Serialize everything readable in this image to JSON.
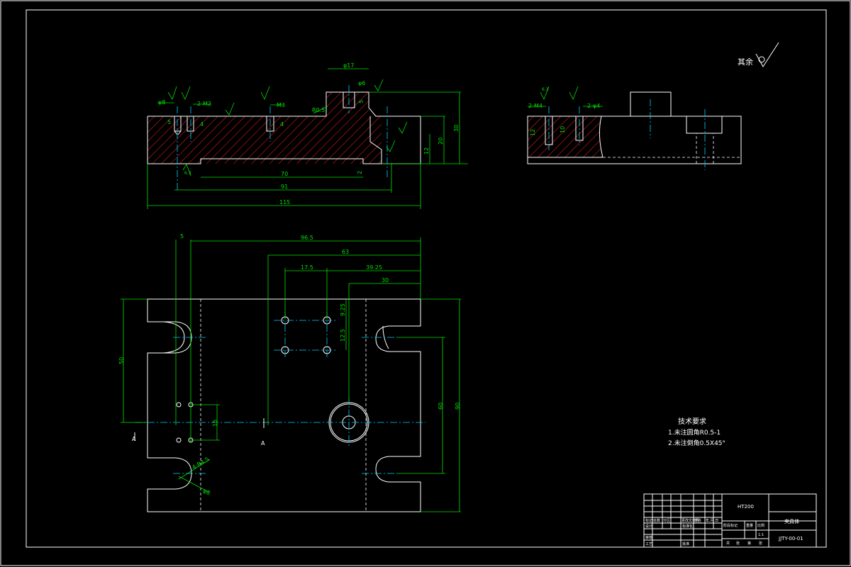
{
  "colors": {
    "background": "#000000",
    "outline": "#ffffff",
    "dimension": "#00e000",
    "centerline": "#00d0ff",
    "hatch": "#ff2020"
  },
  "surface_note": {
    "label": "其余"
  },
  "front_view": {
    "dims": {
      "d17": "φ17",
      "d6": "φ6",
      "d8": "φ8",
      "m2": "M2",
      "two_m2": "2-M2",
      "m3": "M3",
      "five": "5",
      "four_a": "4",
      "four_b": "4",
      "r": "R0.5",
      "seventy": "70",
      "ninety_one": "91",
      "one_fifteen": "115",
      "thirty": "30",
      "twenty": "20",
      "twelve": "12",
      "two": "2",
      "five_b": "5"
    },
    "roughness": "6.3"
  },
  "side_view": {
    "dims": {
      "two_m4": "2-M4",
      "two_d4": "2-φ4",
      "twelve": "12",
      "ten": "10"
    },
    "roughness": "6.3"
  },
  "top_view": {
    "dims": {
      "five": "5",
      "ninety_six_five": "96.5",
      "sixty_three": "63",
      "seventeen_five": "17.5",
      "thirty_nine_25": "39.25",
      "thirty": "30",
      "nine_25": "9.25",
      "twelve_five": "12.5",
      "ninety": "90",
      "sixty": "60",
      "fifty": "50",
      "fifteen": "15",
      "r_label": "4-R4.5",
      "d_label": "φ8"
    },
    "section_marks": [
      "A",
      "A"
    ]
  },
  "tech_requirements": {
    "title": "技术要求",
    "items": [
      "1.未注圆角R0.5-1",
      "2.未注倒角0.5X45°"
    ]
  },
  "title_block": {
    "material": "HT200",
    "part_name": "夹具体",
    "drawing_no": "JJTY-00-01",
    "row_labels": [
      "标记",
      "设计",
      "审核",
      "工艺"
    ],
    "header_cells": [
      "处数",
      "分区",
      "更改文件号",
      "签名",
      "年.月.日"
    ],
    "std_label": "标准化",
    "approve_label": "批准",
    "stage_label": "阶段标记",
    "weight_label": "重量",
    "scale_label": "比例",
    "scale_value": "1:1",
    "sheet_cells": [
      "共",
      "张",
      "第",
      "张"
    ]
  }
}
